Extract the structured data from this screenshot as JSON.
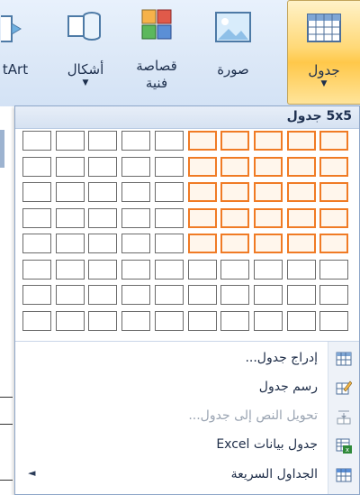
{
  "ribbon": {
    "table_label": "جدول",
    "picture_label": "صورة",
    "clipart_label_line1": "قصاصة",
    "clipart_label_line2": "فنية",
    "shapes_label": "أشكال",
    "smartart_label": "tArt"
  },
  "dropdown": {
    "title": "5x5 جدول",
    "grid": {
      "columns": 10,
      "rows": 8,
      "selected_columns": 5,
      "selected_rows": 5
    },
    "menu_items": [
      {
        "label": "إدراج جدول...",
        "icon": "insert-table-icon",
        "enabled": true
      },
      {
        "label": "رسم جدول",
        "icon": "draw-table-icon",
        "enabled": true
      },
      {
        "label": "تحويل النص إلى جدول...",
        "icon": "convert-text-icon",
        "enabled": false
      },
      {
        "label": "جدول بيانات Excel",
        "icon": "excel-sheet-icon",
        "enabled": true
      },
      {
        "label": "الجداول السريعة",
        "icon": "quick-tables-icon",
        "enabled": true,
        "submenu_arrow": "◄"
      }
    ]
  },
  "colors": {
    "selection_border": "#f07b25",
    "ribbon_bg": "#dce8f7",
    "active_button": "#ffd978"
  }
}
